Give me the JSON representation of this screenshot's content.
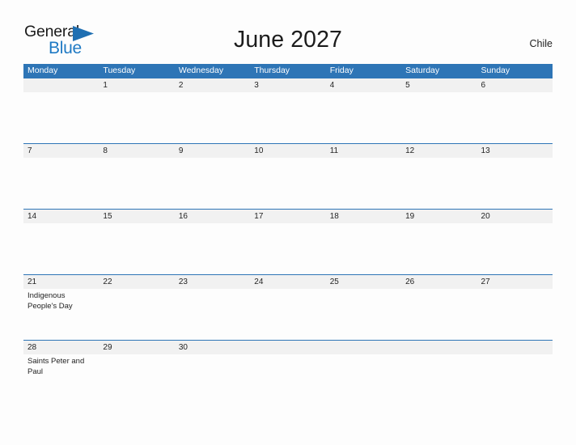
{
  "brand": {
    "line1": "General",
    "line2": "Blue",
    "flag_icon": "blue-triangle-flag",
    "accent_color": "#1f7ac4"
  },
  "header": {
    "title": "June 2027",
    "region": "Chile"
  },
  "theme": {
    "header_blue": "#2e75b6",
    "date_band_gray": "#f1f1f1",
    "page_background": "#fdfdfd",
    "text_dark": "#242424"
  },
  "calendar": {
    "weekday_headers": [
      "Monday",
      "Tuesday",
      "Wednesday",
      "Thursday",
      "Friday",
      "Saturday",
      "Sunday"
    ],
    "weeks": [
      {
        "days": [
          {
            "date": "",
            "event": ""
          },
          {
            "date": "1",
            "event": ""
          },
          {
            "date": "2",
            "event": ""
          },
          {
            "date": "3",
            "event": ""
          },
          {
            "date": "4",
            "event": ""
          },
          {
            "date": "5",
            "event": ""
          },
          {
            "date": "6",
            "event": ""
          }
        ]
      },
      {
        "days": [
          {
            "date": "7",
            "event": ""
          },
          {
            "date": "8",
            "event": ""
          },
          {
            "date": "9",
            "event": ""
          },
          {
            "date": "10",
            "event": ""
          },
          {
            "date": "11",
            "event": ""
          },
          {
            "date": "12",
            "event": ""
          },
          {
            "date": "13",
            "event": ""
          }
        ]
      },
      {
        "days": [
          {
            "date": "14",
            "event": ""
          },
          {
            "date": "15",
            "event": ""
          },
          {
            "date": "16",
            "event": ""
          },
          {
            "date": "17",
            "event": ""
          },
          {
            "date": "18",
            "event": ""
          },
          {
            "date": "19",
            "event": ""
          },
          {
            "date": "20",
            "event": ""
          }
        ]
      },
      {
        "days": [
          {
            "date": "21",
            "event": "Indigenous People's Day"
          },
          {
            "date": "22",
            "event": ""
          },
          {
            "date": "23",
            "event": ""
          },
          {
            "date": "24",
            "event": ""
          },
          {
            "date": "25",
            "event": ""
          },
          {
            "date": "26",
            "event": ""
          },
          {
            "date": "27",
            "event": ""
          }
        ]
      },
      {
        "days": [
          {
            "date": "28",
            "event": "Saints Peter and Paul"
          },
          {
            "date": "29",
            "event": ""
          },
          {
            "date": "30",
            "event": ""
          },
          {
            "date": "",
            "event": ""
          },
          {
            "date": "",
            "event": ""
          },
          {
            "date": "",
            "event": ""
          },
          {
            "date": "",
            "event": ""
          }
        ]
      }
    ]
  }
}
